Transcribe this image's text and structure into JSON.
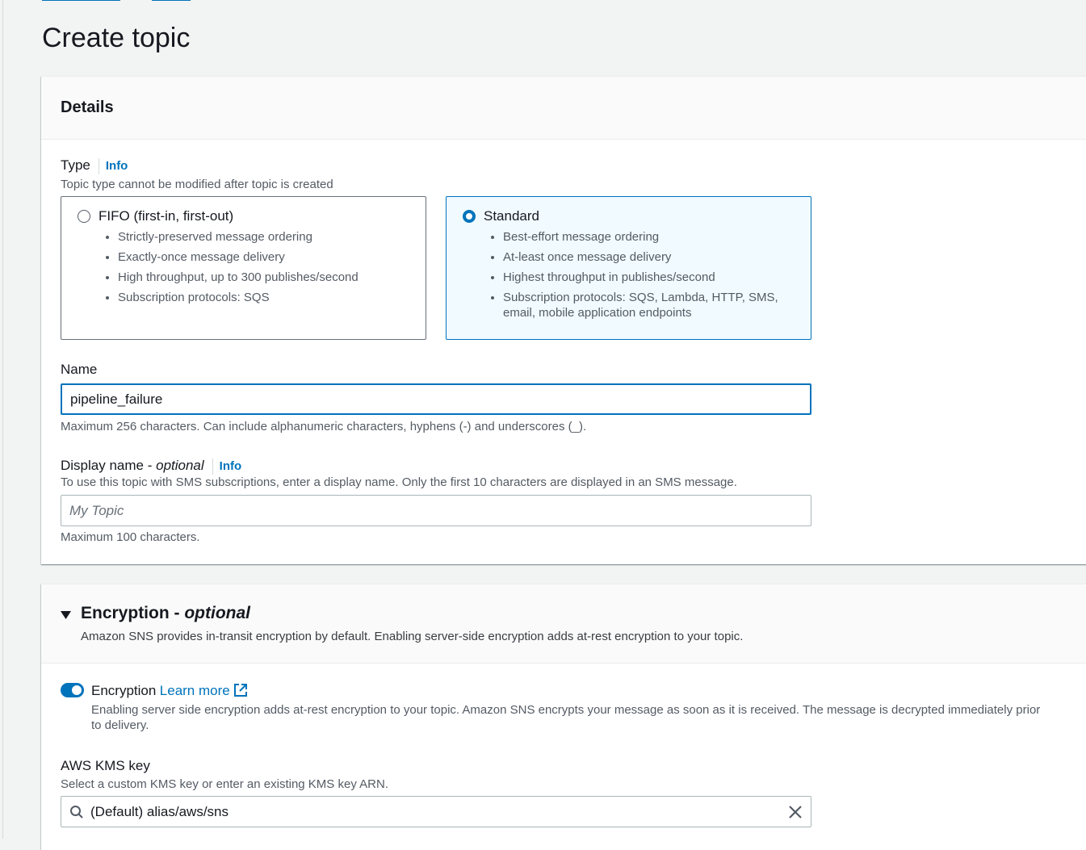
{
  "page": {
    "title": "Create topic"
  },
  "details": {
    "header": "Details",
    "type": {
      "label": "Type",
      "info": "Info",
      "description": "Topic type cannot be modified after topic is created",
      "options": [
        {
          "label": "FIFO (first-in, first-out)",
          "selected": false,
          "bullets": [
            "Strictly-preserved message ordering",
            "Exactly-once message delivery",
            "High throughput, up to 300 publishes/second",
            "Subscription protocols: SQS"
          ]
        },
        {
          "label": "Standard",
          "selected": true,
          "bullets": [
            "Best-effort message ordering",
            "At-least once message delivery",
            "Highest throughput in publishes/second",
            "Subscription protocols: SQS, Lambda, HTTP, SMS, email, mobile application endpoints"
          ]
        }
      ]
    },
    "name": {
      "label": "Name",
      "value": "pipeline_failure",
      "constraint": "Maximum 256 characters. Can include alphanumeric characters, hyphens (-) and underscores (_)."
    },
    "display_name": {
      "label": "Display name - ",
      "optional": "optional",
      "info": "Info",
      "description": "To use this topic with SMS subscriptions, enter a display name. Only the first 10 characters are displayed in an SMS message.",
      "placeholder": "My Topic",
      "constraint": "Maximum 100 characters."
    }
  },
  "encryption": {
    "header": "Encryption - ",
    "header_optional": "optional",
    "description": "Amazon SNS provides in-transit encryption by default. Enabling server-side encryption adds at-rest encryption to your topic.",
    "toggle": {
      "label": "Encryption",
      "learn_more": "Learn more",
      "enabled": true,
      "description": "Enabling server side encryption adds at-rest encryption to your topic. Amazon SNS encrypts your message as soon as it is received. The message is decrypted immediately prior to delivery."
    },
    "kms_key": {
      "label": "AWS KMS key",
      "description": "Select a custom KMS key or enter an existing KMS key ARN.",
      "value": "(Default) alias/aws/sns"
    }
  },
  "icons": {
    "expand": "caret-down-icon",
    "external": "external-link-icon",
    "search": "search-icon",
    "clear": "close-icon"
  },
  "colors": {
    "accent": "#0073bb",
    "text": "#16191f",
    "muted": "#545b64"
  }
}
